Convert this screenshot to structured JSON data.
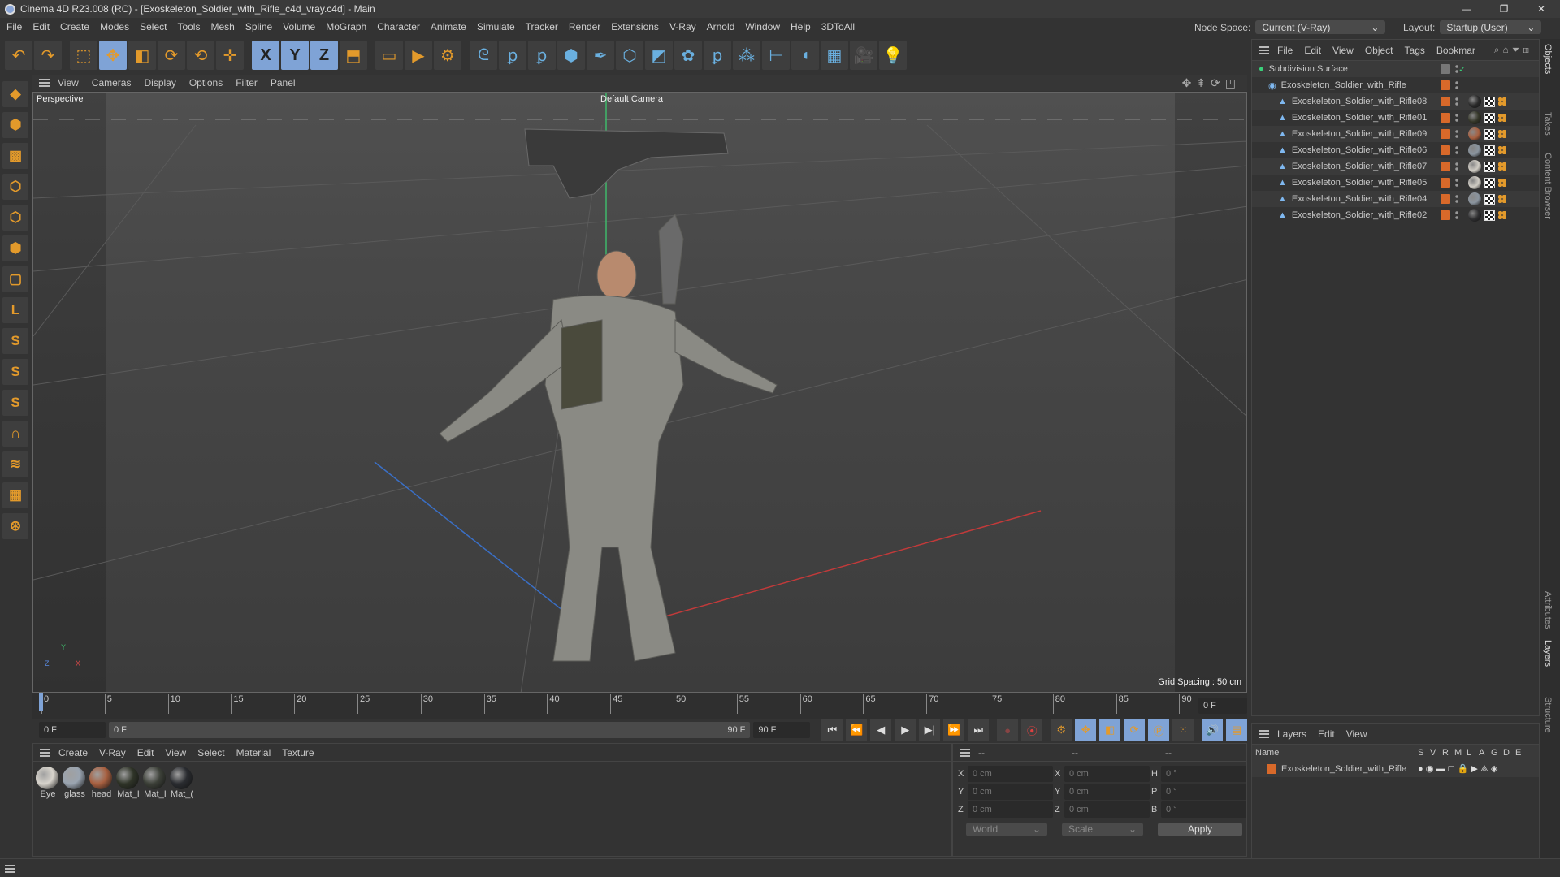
{
  "window": {
    "title": "Cinema 4D R23.008 (RC) - [Exoskeleton_Soldier_with_Rifle_c4d_vray.c4d] - Main",
    "controls": [
      "—",
      "❐",
      "✕"
    ]
  },
  "menu": [
    "File",
    "Edit",
    "Create",
    "Modes",
    "Select",
    "Tools",
    "Mesh",
    "Spline",
    "Volume",
    "MoGraph",
    "Character",
    "Animate",
    "Simulate",
    "Tracker",
    "Render",
    "Extensions",
    "V-Ray",
    "Arnold",
    "Window",
    "Help",
    "3DToAll"
  ],
  "node_space": {
    "label": "Node Space:",
    "value": "Current (V-Ray)"
  },
  "layout": {
    "label": "Layout:",
    "value": "Startup (User)"
  },
  "toolbar": [
    {
      "icon": "undo-icon",
      "g": "↶"
    },
    {
      "icon": "redo-icon",
      "g": "↷"
    },
    {
      "icon": "live-select-icon",
      "g": "⬚"
    },
    {
      "icon": "move-icon",
      "g": "✥",
      "on": true
    },
    {
      "icon": "scale-icon",
      "g": "◧"
    },
    {
      "icon": "rotate-icon",
      "g": "⟳"
    },
    {
      "icon": "psr-icon",
      "g": "⟲"
    },
    {
      "icon": "add-icon",
      "g": "✛"
    },
    {
      "icon": "x-axis-icon",
      "g": "X",
      "on": true
    },
    {
      "icon": "y-axis-icon",
      "g": "Y",
      "on": true
    },
    {
      "icon": "z-axis-icon",
      "g": "Z",
      "on": true
    },
    {
      "icon": "coordinate-system-icon",
      "g": "⬒"
    },
    {
      "icon": "render-view-icon",
      "g": "▭"
    },
    {
      "icon": "render-picture-viewer-icon",
      "g": "▶"
    },
    {
      "icon": "render-settings-icon",
      "g": "⚙"
    },
    {
      "icon": "vray-icon",
      "g": "ᘓ"
    },
    {
      "icon": "python-icon",
      "g": "ꝑ"
    },
    {
      "icon": "python-icon-2",
      "g": "ꝑ"
    },
    {
      "icon": "cube-icon",
      "g": "⬢"
    },
    {
      "icon": "pen-icon",
      "g": "✒"
    },
    {
      "icon": "subdivision-icon",
      "g": "⬡"
    },
    {
      "icon": "extrude-icon",
      "g": "◩"
    },
    {
      "icon": "cloner-icon",
      "g": "✿"
    },
    {
      "icon": "python-icon-3",
      "g": "ꝑ"
    },
    {
      "icon": "mograph-icon",
      "g": "⁂"
    },
    {
      "icon": "deformer-icon",
      "g": "⊢"
    },
    {
      "icon": "field-icon",
      "g": "◖"
    },
    {
      "icon": "floor-icon",
      "g": "▦"
    },
    {
      "icon": "camera-icon",
      "g": "🎥"
    },
    {
      "icon": "light-icon",
      "g": "💡"
    }
  ],
  "left_tools": [
    {
      "icon": "make-editable-icon",
      "g": "◆"
    },
    {
      "icon": "model-mode-icon",
      "g": "⬢"
    },
    {
      "icon": "texture-mode-icon",
      "g": "▩"
    },
    {
      "icon": "points-mode-icon",
      "g": "⬡"
    },
    {
      "icon": "edges-mode-icon",
      "g": "⬡"
    },
    {
      "icon": "polygons-mode-icon",
      "g": "⬢"
    },
    {
      "icon": "uv-mode-icon",
      "g": "▢"
    },
    {
      "icon": "axis-icon",
      "g": "L"
    },
    {
      "icon": "snap-icon",
      "g": "S"
    },
    {
      "icon": "snap-settings-icon",
      "g": "S"
    },
    {
      "icon": "quantize-icon",
      "g": "S"
    },
    {
      "icon": "magnet-icon",
      "g": "∩"
    },
    {
      "icon": "workplane-icon",
      "g": "≋"
    },
    {
      "icon": "grid-icon",
      "g": "▦"
    },
    {
      "icon": "locked-workplane-icon",
      "g": "⊛"
    }
  ],
  "viewport": {
    "menu": [
      "View",
      "Cameras",
      "Display",
      "Options",
      "Filter",
      "Panel"
    ],
    "view_name": "Perspective",
    "camera": "Default Camera",
    "grid_spacing": "Grid Spacing : 50 cm",
    "axis_labels": [
      "Y",
      "Z",
      "X"
    ]
  },
  "timeline": {
    "ticks": [
      "0",
      "5",
      "10",
      "15",
      "20",
      "25",
      "30",
      "35",
      "40",
      "45",
      "50",
      "55",
      "60",
      "65",
      "70",
      "75",
      "80",
      "85",
      "90"
    ],
    "current_frame": "0 F",
    "start": "0 F",
    "range_start": "0 F",
    "range_end": "90 F",
    "end": "90 F"
  },
  "materials": {
    "menu": [
      "Create",
      "V-Ray",
      "Edit",
      "View",
      "Select",
      "Material",
      "Texture"
    ],
    "items": [
      {
        "name": "Eye",
        "color": "#d8d4cc"
      },
      {
        "name": "glass",
        "color": "#9aa4b0"
      },
      {
        "name": "head",
        "color": "#a86040"
      },
      {
        "name": "Mat_I",
        "color": "#2f3428"
      },
      {
        "name": "Mat_I",
        "color": "#3c4038"
      },
      {
        "name": "Mat_(",
        "color": "#2a2c30"
      }
    ]
  },
  "coordinates": {
    "headers": [
      "--",
      "--",
      "--"
    ],
    "rows": [
      {
        "a": "X",
        "v1": "0 cm",
        "b": "X",
        "v2": "0 cm",
        "c": "H",
        "v3": "0 °"
      },
      {
        "a": "Y",
        "v1": "0 cm",
        "b": "Y",
        "v2": "0 cm",
        "c": "P",
        "v3": "0 °"
      },
      {
        "a": "Z",
        "v1": "0 cm",
        "b": "Z",
        "v2": "0 cm",
        "c": "B",
        "v3": "0 °"
      }
    ],
    "mode": "World",
    "type": "Scale",
    "apply": "Apply"
  },
  "objects": {
    "menu": [
      "File",
      "Edit",
      "View",
      "Object",
      "Tags",
      "Bookmar"
    ],
    "items": [
      {
        "name": "Subdivision Surface",
        "level": 0,
        "type": "subdiv"
      },
      {
        "name": "Exoskeleton_Soldier_with_Rifle",
        "level": 1,
        "type": "null"
      },
      {
        "name": "Exoskeleton_Soldier_with_Rifle08",
        "level": 2,
        "mat": "#2a2a2a"
      },
      {
        "name": "Exoskeleton_Soldier_with_Rifle01",
        "level": 2,
        "mat": "#343628"
      },
      {
        "name": "Exoskeleton_Soldier_with_Rifle09",
        "level": 2,
        "mat": "#a86040"
      },
      {
        "name": "Exoskeleton_Soldier_with_Rifle06",
        "level": 2,
        "mat": "#8a949e"
      },
      {
        "name": "Exoskeleton_Soldier_with_Rifle07",
        "level": 2,
        "mat": "#d0ccc4"
      },
      {
        "name": "Exoskeleton_Soldier_with_Rifle05",
        "level": 2,
        "mat": "#d0ccc4"
      },
      {
        "name": "Exoskeleton_Soldier_with_Rifle04",
        "level": 2,
        "mat": "#8a949e"
      },
      {
        "name": "Exoskeleton_Soldier_with_Rifle02",
        "level": 2,
        "mat": "#2e2e30"
      }
    ]
  },
  "layers": {
    "menu": [
      "Layers",
      "Edit",
      "View"
    ],
    "columns": [
      "Name",
      "S",
      "V",
      "R",
      "M",
      "L",
      "A",
      "G",
      "D",
      "E"
    ],
    "items": [
      {
        "name": "Exoskeleton_Soldier_with_Rifle",
        "color": "#d8692a"
      }
    ]
  },
  "side_tabs": [
    "Objects",
    "Takes",
    "Content Browser",
    "Attributes",
    "Layers",
    "Structure"
  ]
}
